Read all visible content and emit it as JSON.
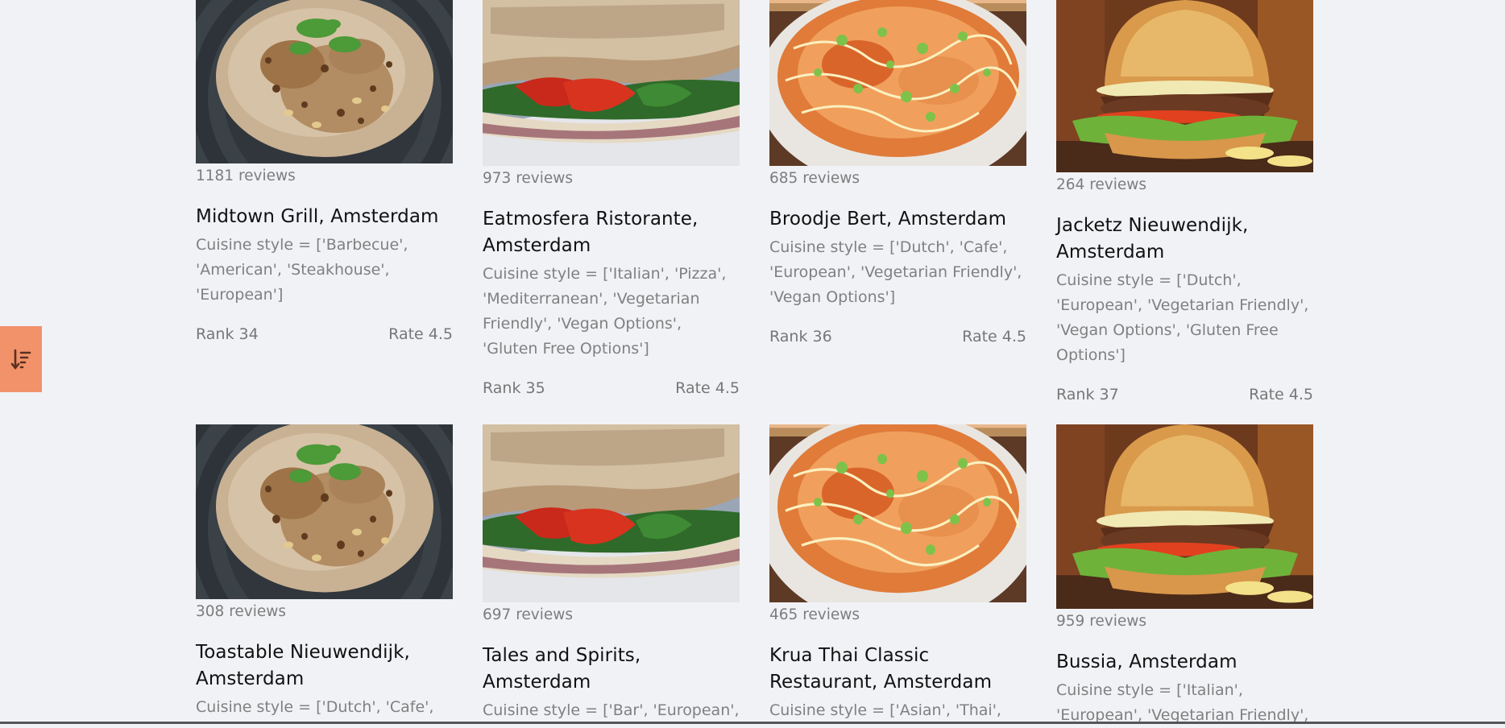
{
  "sort_button": {
    "icon": "sort-descending-icon",
    "color": "#f1926b"
  },
  "restaurants": [
    {
      "reviews": "1181 reviews",
      "name": "Midtown Grill, Amsterdam",
      "cuisine": "Cuisine style = ['Barbecue', 'American', 'Steakhouse', 'European']",
      "rank": "Rank 34",
      "rate": "Rate 4.5",
      "image": "rice-dish-photo"
    },
    {
      "reviews": "973 reviews",
      "name": "Eatmosfera Ristorante, Amsterdam",
      "cuisine": "Cuisine style = ['Italian', 'Pizza', 'Mediterranean', 'Vegetarian Friendly', 'Vegan Options', 'Gluten Free Options']",
      "rank": "Rank 35",
      "rate": "Rate 4.5",
      "image": "sandwich-photo"
    },
    {
      "reviews": "685 reviews",
      "name": "Broodje Bert, Amsterdam",
      "cuisine": "Cuisine style = ['Dutch', 'Cafe', 'European', 'Vegetarian Friendly', 'Vegan Options']",
      "rank": "Rank 36",
      "rate": "Rate 4.5",
      "image": "noodle-bowl-photo"
    },
    {
      "reviews": "264 reviews",
      "name": "Jacketz Nieuwendijk, Amsterdam",
      "cuisine": "Cuisine style = ['Dutch', 'European', 'Vegetarian Friendly', 'Vegan Options', 'Gluten Free Options']",
      "rank": "Rank 37",
      "rate": "Rate 4.5",
      "image": "burger-photo"
    },
    {
      "reviews": "308 reviews",
      "name": "Toastable Nieuwendijk, Amsterdam",
      "cuisine": "Cuisine style = ['Dutch', 'Cafe',",
      "rank": "",
      "rate": "",
      "image": "rice-dish-photo"
    },
    {
      "reviews": "697 reviews",
      "name": "Tales and Spirits, Amsterdam",
      "cuisine": "Cuisine style = ['Bar', 'European',",
      "rank": "",
      "rate": "",
      "image": "sandwich-photo"
    },
    {
      "reviews": "465 reviews",
      "name": "Krua Thai Classic Restaurant, Amsterdam",
      "cuisine": "Cuisine style = ['Asian', 'Thai',",
      "rank": "",
      "rate": "",
      "image": "noodle-bowl-photo"
    },
    {
      "reviews": "959 reviews",
      "name": "Bussia, Amsterdam",
      "cuisine": "Cuisine style = ['Italian', 'European', 'Vegetarian Friendly',",
      "rank": "",
      "rate": "",
      "image": "burger-photo"
    }
  ]
}
